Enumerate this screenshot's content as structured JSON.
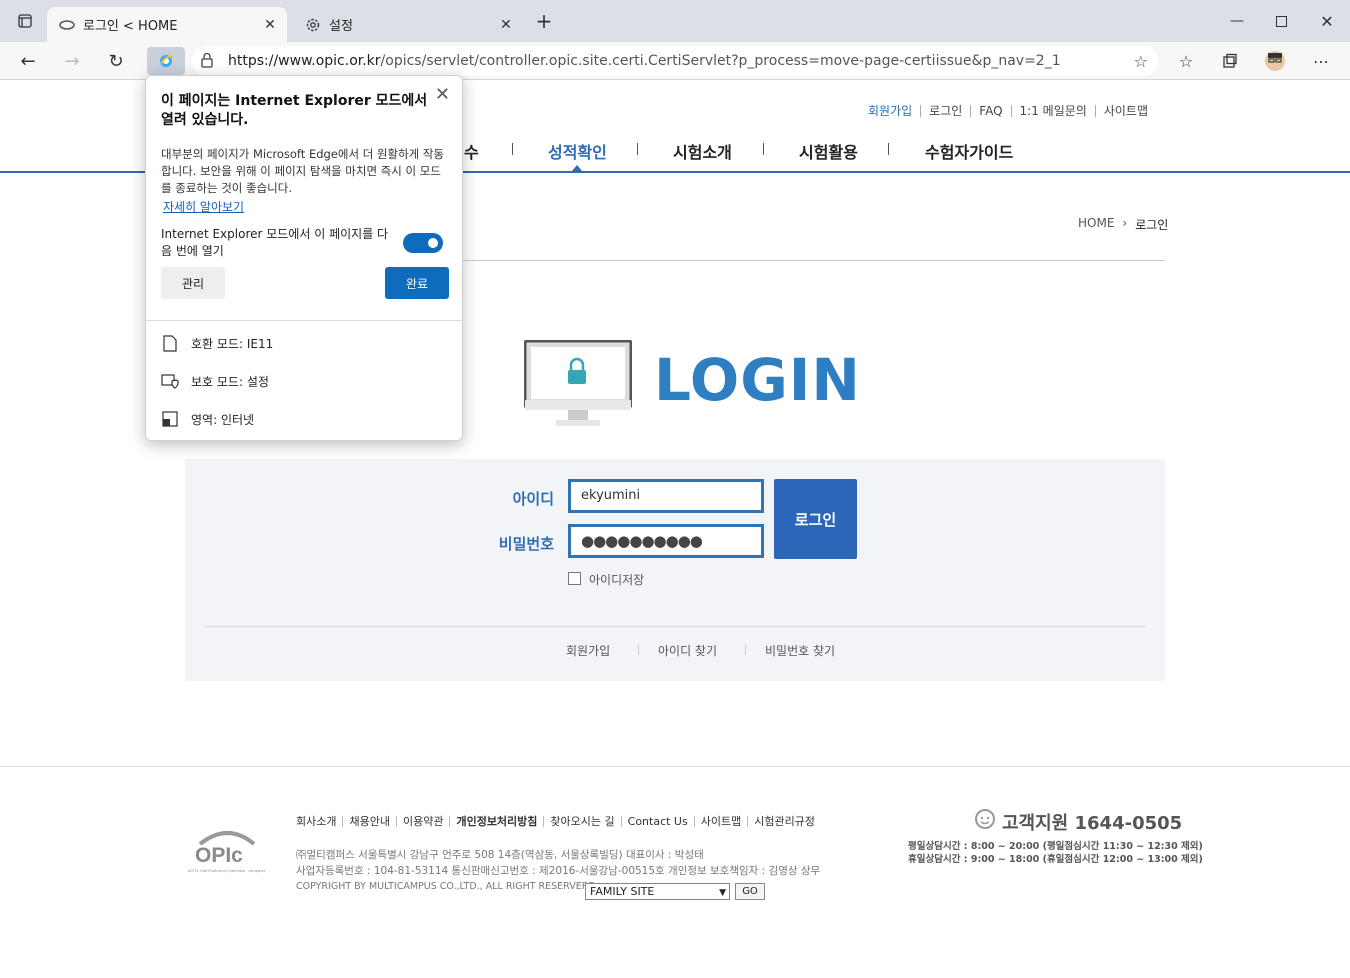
{
  "browser": {
    "tabs": [
      {
        "title": "로그인 < HOME",
        "active": true
      },
      {
        "title": "설정",
        "active": false
      }
    ],
    "url_host": "https://www.opic.or.kr",
    "url_path": "/opics/servlet/controller.opic.site.certi.CertiServlet?p_process=move-page-certiissue&p_nav=2_1"
  },
  "site": {
    "util_links": [
      "회원가입",
      "로그인",
      "FAQ",
      "1:1 메일문의",
      "사이트맵"
    ],
    "gnb": [
      "수",
      "성적확인",
      "시험소개",
      "시험활용",
      "수험자가이드"
    ],
    "breadcrumb": {
      "home": "HOME",
      "current": "로그인"
    },
    "login_title": "LOGIN",
    "id_label": "아이디",
    "pw_label": "비밀번호",
    "id_value": "ekyumini",
    "pw_value": "●●●●●●●●●●",
    "login_button": "로그인",
    "save_id_label": "아이디저장",
    "bottom_links": [
      "회원가입",
      "아이디 찾기",
      "비밀번호 찾기"
    ]
  },
  "footer": {
    "links": [
      "회사소개",
      "채용안내",
      "이용약관",
      "개인정보처리방침",
      "찾아오시는 길",
      "Contact Us",
      "사이트맵",
      "시험관리규정"
    ],
    "addr1": "㈜멀티캠퍼스 서울특별시 강남구 언주로 508 14층(역삼동, 서울상록빌딩)    대표이사 : 박성태",
    "addr2": "사업자등록번호 : 104-81-53114    통신판매신고번호 : 제2016-서울강남-00515호    개인정보 보호책임자 : 김영상 상무",
    "copyright": "COPYRIGHT BY MULTICAMPUS CO.,LTD., ALL RIGHT RESERVERD.",
    "family_site": "FAMILY SITE",
    "go": "GO",
    "cs_title": "고객지원 1644-0505",
    "hours1": "평일상담시간 : 8:00 ~ 20:00 (평일점심시간 11:30 ~ 12:30 제외)",
    "hours2": "휴일상담시간 : 9:00 ~ 18:00 (휴일점심시간 12:00 ~ 13:00 제외)",
    "logo_text": "OPIc",
    "logo_sub": "ACTFL Oral Proficiency Interview - computer"
  },
  "popup": {
    "title": "이 페이지는 Internet Explorer 모드에서 열려 있습니다.",
    "desc": "대부분의 페이지가 Microsoft Edge에서 더 원활하게 작동합니다. 보안을 위해 이 페이지 탐색을 마치면 즉시 이 모드를 종료하는 것이 좋습니다.",
    "link": "자세히 알아보기",
    "toggle_text": "Internet Explorer 모드에서 이 페이지를 다음 번에 열기",
    "toggle_on": true,
    "manage": "관리",
    "done": "완료",
    "info": [
      "호환 모드: IE11",
      "보호 모드: 설정",
      "영역: 인터넷"
    ]
  },
  "colors": {
    "accent": "#2f6ab7",
    "edge_blue": "#0f6cbd",
    "login_title": "#2e7ec2"
  }
}
